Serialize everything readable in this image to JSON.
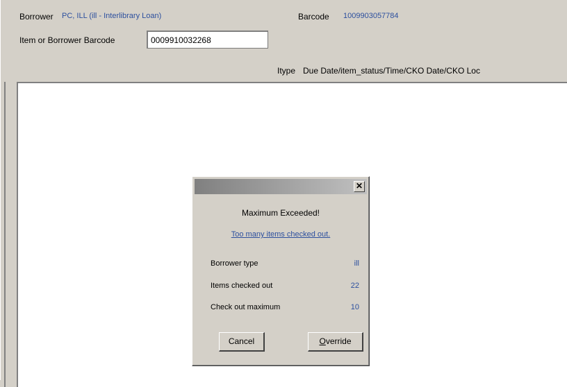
{
  "header": {
    "borrower_label": "Borrower",
    "borrower_value": "PC, ILL (ill - Interlibrary Loan)",
    "barcode_label": "Barcode",
    "barcode_value": "1009903057784",
    "item_barcode_label": "Item or Borrower Barcode",
    "item_barcode_value": "0009910032268"
  },
  "columns": {
    "itype": "Itype",
    "due": "Due Date/item_status/Time/CKO Date/CKO Loc"
  },
  "dialog": {
    "title": "",
    "close_glyph": "✕",
    "heading": "Maximum Exceeded!",
    "message": "Too many items checked out.",
    "rows": [
      {
        "label": "Borrower type",
        "value": "ill"
      },
      {
        "label": "Items checked out",
        "value": "22"
      },
      {
        "label": "Check out maximum",
        "value": "10"
      }
    ],
    "cancel_label": "Cancel",
    "override_label": "Override",
    "override_mnemonic": "O",
    "override_rest": "verride"
  }
}
